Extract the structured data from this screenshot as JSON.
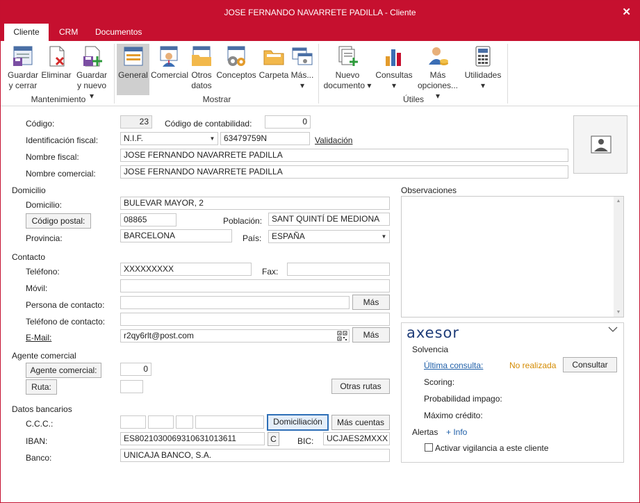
{
  "window": {
    "title": "JOSE FERNANDO NAVARRETE PADILLA - Cliente",
    "close_glyph": "✕"
  },
  "tabs": [
    "Cliente",
    "CRM",
    "Documentos"
  ],
  "ribbon": {
    "buttons": [
      {
        "line1": "Guardar",
        "line2": "y cerrar"
      },
      {
        "line1": "Eliminar",
        "line2": ""
      },
      {
        "line1": "Guardar",
        "line2": "y nuevo ▾"
      },
      {
        "line1": "General",
        "line2": ""
      },
      {
        "line1": "Comercial",
        "line2": ""
      },
      {
        "line1": "Otros",
        "line2": "datos"
      },
      {
        "line1": "Conceptos",
        "line2": ""
      },
      {
        "line1": "Carpeta",
        "line2": ""
      },
      {
        "line1": "Más...",
        "line2": "▾"
      },
      {
        "line1": "Nuevo",
        "line2": "documento ▾"
      },
      {
        "line1": "Consultas",
        "line2": "▾"
      },
      {
        "line1": "Más",
        "line2": "opciones... ▾"
      },
      {
        "line1": "Utilidades",
        "line2": "▾"
      }
    ],
    "groups": [
      "Mantenimiento",
      "Mostrar",
      "Útiles"
    ]
  },
  "labels": {
    "codigo": "Código:",
    "codigo_contab": "Código de contabilidad:",
    "ident_fiscal": "Identificación fiscal:",
    "nombre_fiscal": "Nombre fiscal:",
    "nombre_comercial": "Nombre comercial:",
    "domicilio_sec": "Domicilio",
    "domicilio": "Domicilio:",
    "cp_button": "Código postal:",
    "poblacion": "Población:",
    "provincia": "Provincia:",
    "pais": "País:",
    "contacto_sec": "Contacto",
    "telefono": "Teléfono:",
    "fax": "Fax:",
    "movil": "Móvil:",
    "persona": "Persona de contacto:",
    "tel_contacto": "Teléfono de contacto:",
    "email": "E-Mail:",
    "mas": "Más",
    "agente_sec": "Agente comercial",
    "agente_btn": "Agente comercial:",
    "ruta_btn": "Ruta:",
    "otras_rutas": "Otras rutas",
    "bancarios_sec": "Datos bancarios",
    "ccc": "C.C.C.:",
    "domiciliacion": "Domiciliación",
    "mas_cuentas": "Más cuentas",
    "iban": "IBAN:",
    "iban_c": "C",
    "bic": "BIC:",
    "banco": "Banco:",
    "validacion": "Validación",
    "observaciones": "Observaciones"
  },
  "values": {
    "codigo": "23",
    "codigo_contab": "0",
    "tipo_ident": "N.I.F.",
    "nif": "63479759N",
    "nombre_fiscal": "JOSE FERNANDO NAVARRETE PADILLA",
    "nombre_comercial": "JOSE FERNANDO NAVARRETE PADILLA",
    "domicilio": "BULEVAR MAYOR, 2",
    "cp": "08865",
    "poblacion": "SANT QUINTÍ DE MEDIONA",
    "provincia": "BARCELONA",
    "pais": "ESPAÑA",
    "telefono": "XXXXXXXXX",
    "fax": "",
    "movil": "",
    "persona": "",
    "tel_contacto": "",
    "email": "r2qy6rlt@post.com",
    "agente": "0",
    "ruta": "",
    "iban": "ES8021030069310631013611",
    "bic": "UCJAES2MXXX",
    "banco": "UNICAJA BANCO, S.A."
  },
  "axesor": {
    "logo": "axesor",
    "solvencia": "Solvencia",
    "ultima_consulta": "Última consulta:",
    "no_realizada": "No realizada",
    "consultar": "Consultar",
    "scoring": "Scoring:",
    "prob_impago": "Probabilidad impago:",
    "max_credito": "Máximo crédito:",
    "alertas": "Alertas",
    "info": "+ Info",
    "vigilancia": "Activar vigilancia a este cliente"
  },
  "colors": {
    "brand": "#c6102f",
    "link": "#1f5fa8",
    "warning": "#d48a00"
  }
}
